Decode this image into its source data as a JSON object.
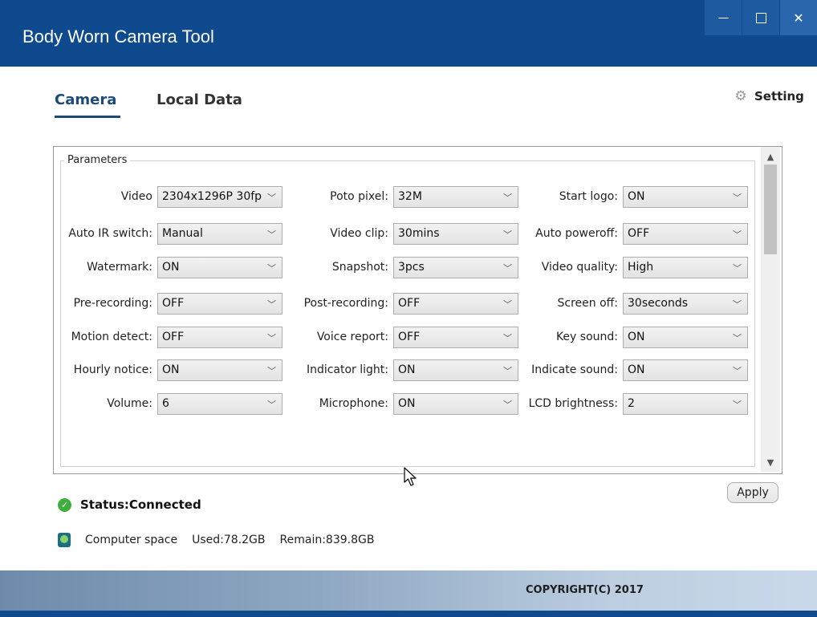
{
  "window": {
    "title": "Body Worn Camera Tool",
    "minimize_label": "",
    "colors": {
      "titlebar": "#0f4a8e",
      "accent": "#1e4a78"
    }
  },
  "tabs": [
    {
      "label": "Camera",
      "active": true
    },
    {
      "label": "Local Data",
      "active": false
    }
  ],
  "setting": {
    "label": "Setting",
    "icon": "gear-icon"
  },
  "parameters": {
    "title": "Parameters",
    "col1": [
      {
        "label": "Video",
        "value": "2304x1296P 30fp"
      },
      {
        "label": "Auto IR switch:",
        "value": "Manual"
      },
      {
        "label": "Watermark:",
        "value": "ON"
      },
      {
        "label": "Pre-recording:",
        "value": "OFF"
      },
      {
        "label": "Motion detect:",
        "value": "OFF"
      },
      {
        "label": "Hourly notice:",
        "value": "ON"
      },
      {
        "label": "Volume:",
        "value": "6"
      }
    ],
    "col2": [
      {
        "label": "Poto pixel:",
        "value": "32M"
      },
      {
        "label": "Video clip:",
        "value": "30mins"
      },
      {
        "label": "Snapshot:",
        "value": "3pcs"
      },
      {
        "label": "Post-recording:",
        "value": "OFF"
      },
      {
        "label": "Voice report:",
        "value": "OFF"
      },
      {
        "label": "Indicator light:",
        "value": "ON"
      },
      {
        "label": "Microphone:",
        "value": "ON"
      }
    ],
    "col3": [
      {
        "label": "Start logo:",
        "value": "ON"
      },
      {
        "label": "Auto poweroff:",
        "value": "OFF"
      },
      {
        "label": "Video quality:",
        "value": "High"
      },
      {
        "label": "Screen off:",
        "value": "30seconds"
      },
      {
        "label": "Key sound:",
        "value": "ON"
      },
      {
        "label": "Indicate sound:",
        "value": "ON"
      },
      {
        "label": "LCD brightness:",
        "value": "2"
      }
    ]
  },
  "apply_label": "Apply",
  "status": {
    "text": "Status:Connected",
    "color": "#3fae3f"
  },
  "space": {
    "label": "Computer space",
    "used": "Used:78.2GB",
    "remain": "Remain:839.8GB"
  },
  "footer": {
    "copyright": "COPYRIGHT(C) 2017"
  }
}
